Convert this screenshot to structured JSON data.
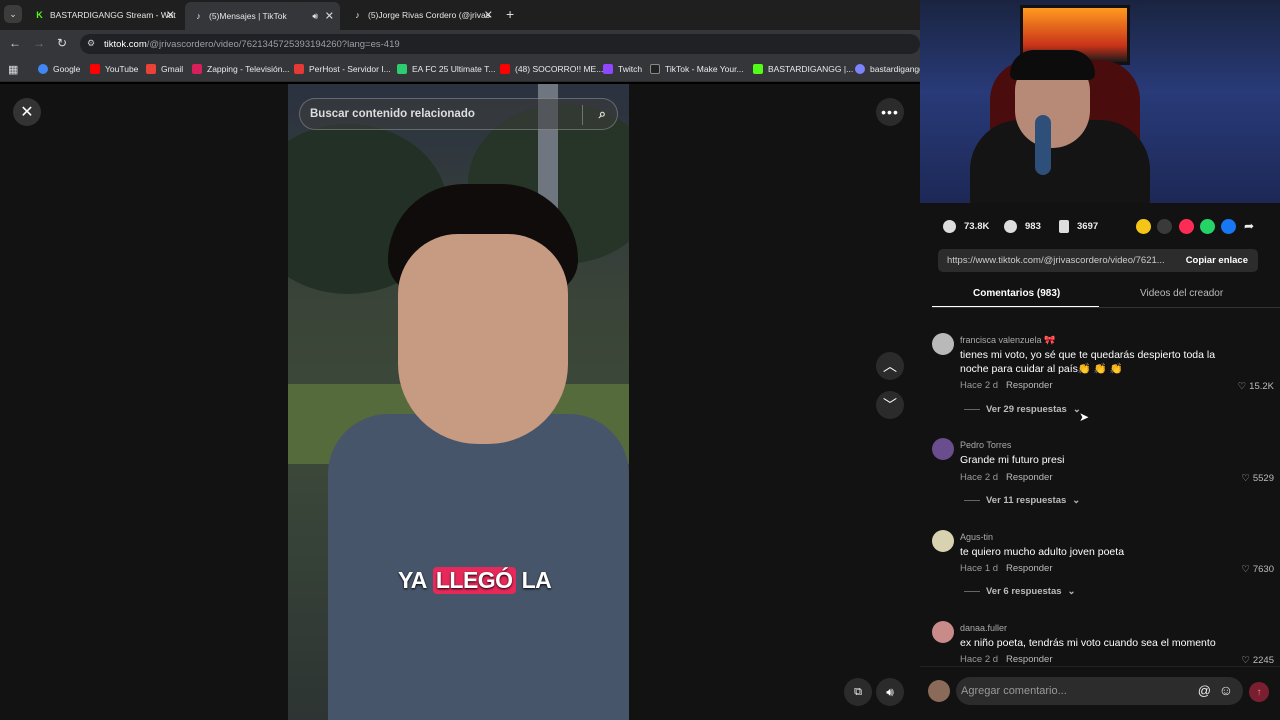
{
  "browser": {
    "tabs": [
      {
        "label": "BASTARDIGANGG Stream - Wat",
        "color": "#53fc18",
        "icon": "kick-icon"
      },
      {
        "label": "(5)Mensajes | TikTok",
        "color": "#000000",
        "icon": "tiktok-icon"
      },
      {
        "label": "(5)Jorge Rivas Cordero (@jrivas",
        "color": "#000000",
        "icon": "tiktok-icon"
      }
    ],
    "url_host": "tiktok.com",
    "url_path": "/@jrivascordero/video/7621345725393194260?lang=es-419",
    "bookmarks": [
      {
        "label": "Google",
        "color": "#4285f4"
      },
      {
        "label": "YouTube",
        "color": "#ff0000"
      },
      {
        "label": "Gmail",
        "color": "#ea4335"
      },
      {
        "label": "Zapping - Televisión...",
        "color": "#d81f5b"
      },
      {
        "label": "PerHost - Servidor I...",
        "color": "#e53935"
      },
      {
        "label": "EA FC 25 Ultimate T...",
        "color": "#2ecc71"
      },
      {
        "label": "(48) SOCORRO!! ME...",
        "color": "#ff0000"
      },
      {
        "label": "Twitch",
        "color": "#9146ff"
      },
      {
        "label": "TikTok - Make Your...",
        "color": "#222222"
      },
      {
        "label": "BASTARDIGANGG |...",
        "color": "#53fc18"
      },
      {
        "label": "bastardigangg",
        "color": "#7c83fd"
      }
    ]
  },
  "video": {
    "search_placeholder": "Buscar contenido relacionado",
    "caption_pre": "YA",
    "caption_highlight": "LLEGÓ",
    "caption_post": "LA"
  },
  "stats": {
    "likes": "73.8K",
    "comments": "983",
    "saves": "3697"
  },
  "link": {
    "url": "https://www.tiktok.com/@jrivascordero/video/7621...",
    "copy_label": "Copiar enlace"
  },
  "tabs": {
    "comments": "Comentarios (983)",
    "creator_videos": "Videos del creador"
  },
  "comments": [
    {
      "user": "francisca valenzuela 🎀",
      "text": "tienes mi voto, yo sé que te quedarás despierto toda la noche para cuidar al país👏 👏 👏",
      "time": "Hace 2 d",
      "reply": "Responder",
      "likes": "15.2K",
      "more": "Ver 29 respuestas",
      "avatar": "#b9b9b9"
    },
    {
      "user": "Pedro Torres",
      "text": "Grande mi futuro presi",
      "time": "Hace 2 d",
      "reply": "Responder",
      "likes": "5529",
      "more": "Ver 11 respuestas",
      "avatar": "#6a4d8c"
    },
    {
      "user": "Agus-tin",
      "text": "te quiero mucho adulto joven poeta",
      "time": "Hace 1 d",
      "reply": "Responder",
      "likes": "7630",
      "more": "Ver 6 respuestas",
      "avatar": "#d8d2b0"
    },
    {
      "user": "danaa.fuller",
      "text": "ex niño poeta, tendrás mi voto cuando sea el momento",
      "time": "Hace 2 d",
      "reply": "Responder",
      "likes": "2245",
      "more": "",
      "avatar": "#c98a8a"
    }
  ],
  "comment_input": {
    "placeholder": "Agregar comentario..."
  }
}
